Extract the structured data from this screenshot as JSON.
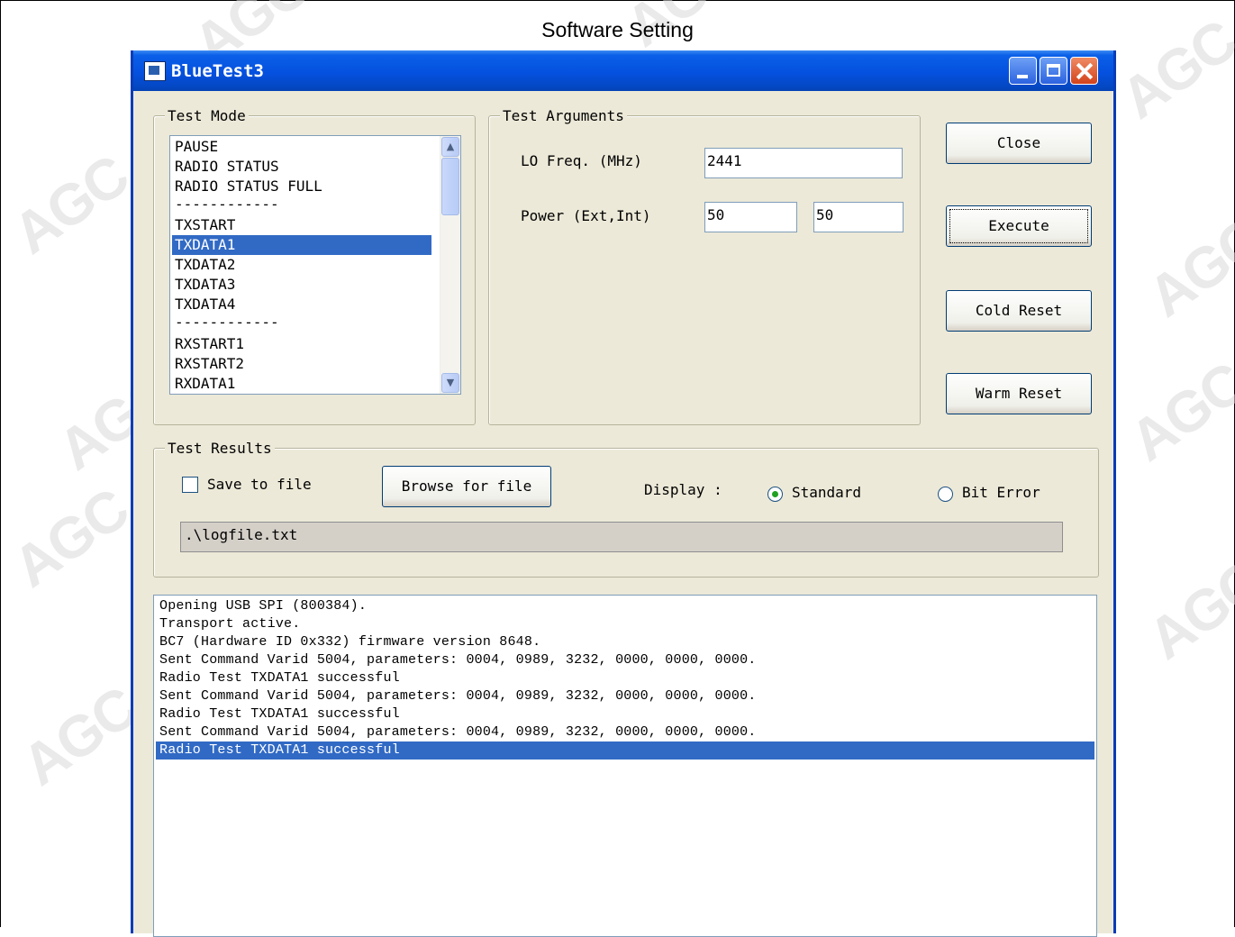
{
  "page": {
    "title": "Software Setting"
  },
  "window": {
    "title": "BlueTest3"
  },
  "test_mode": {
    "label": "Test Mode",
    "items": [
      "PAUSE",
      "RADIO STATUS",
      "RADIO STATUS FULL",
      "------------",
      "TXSTART",
      "TXDATA1",
      "TXDATA2",
      "TXDATA3",
      "TXDATA4",
      "------------",
      "RXSTART1",
      "RXSTART2",
      "RXDATA1"
    ],
    "selected": "TXDATA1"
  },
  "test_arguments": {
    "label": "Test Arguments",
    "lo_freq_label": "LO Freq. (MHz)",
    "lo_freq_value": "2441",
    "power_label": "Power (Ext,Int)",
    "power_ext_value": "50",
    "power_int_value": "50"
  },
  "buttons": {
    "close": "Close",
    "execute": "Execute",
    "cold_reset": "Cold Reset",
    "warm_reset": "Warm Reset",
    "browse": "Browse for file"
  },
  "test_results": {
    "label": "Test Results",
    "save_to_file_label": "Save to file",
    "save_to_file_checked": false,
    "display_label": "Display :",
    "display_options": [
      "Standard",
      "Bit Error"
    ],
    "display_selected": "Standard",
    "log_path": ".\\logfile.txt"
  },
  "log": {
    "lines": [
      "Opening USB SPI (800384).",
      "Transport active.",
      "BC7 (Hardware ID 0x332) firmware version 8648.",
      "Sent Command Varid 5004, parameters: 0004, 0989, 3232, 0000, 0000, 0000.",
      "Radio Test TXDATA1 successful",
      "Sent Command Varid 5004, parameters: 0004, 0989, 3232, 0000, 0000, 0000.",
      "Radio Test TXDATA1 successful",
      "Sent Command Varid 5004, parameters: 0004, 0989, 3232, 0000, 0000, 0000.",
      "Radio Test TXDATA1 successful"
    ],
    "selected_index": 8
  },
  "icons": {
    "app": "app-window-icon",
    "minimize": "minimize-icon",
    "maximize": "maximize-icon",
    "close": "close-icon",
    "scroll_up": "chevron-up-icon",
    "scroll_down": "chevron-down-icon"
  },
  "colors": {
    "titlebar": "#0551df",
    "selection": "#316ac5",
    "dialog_bg": "#ece9d8"
  }
}
